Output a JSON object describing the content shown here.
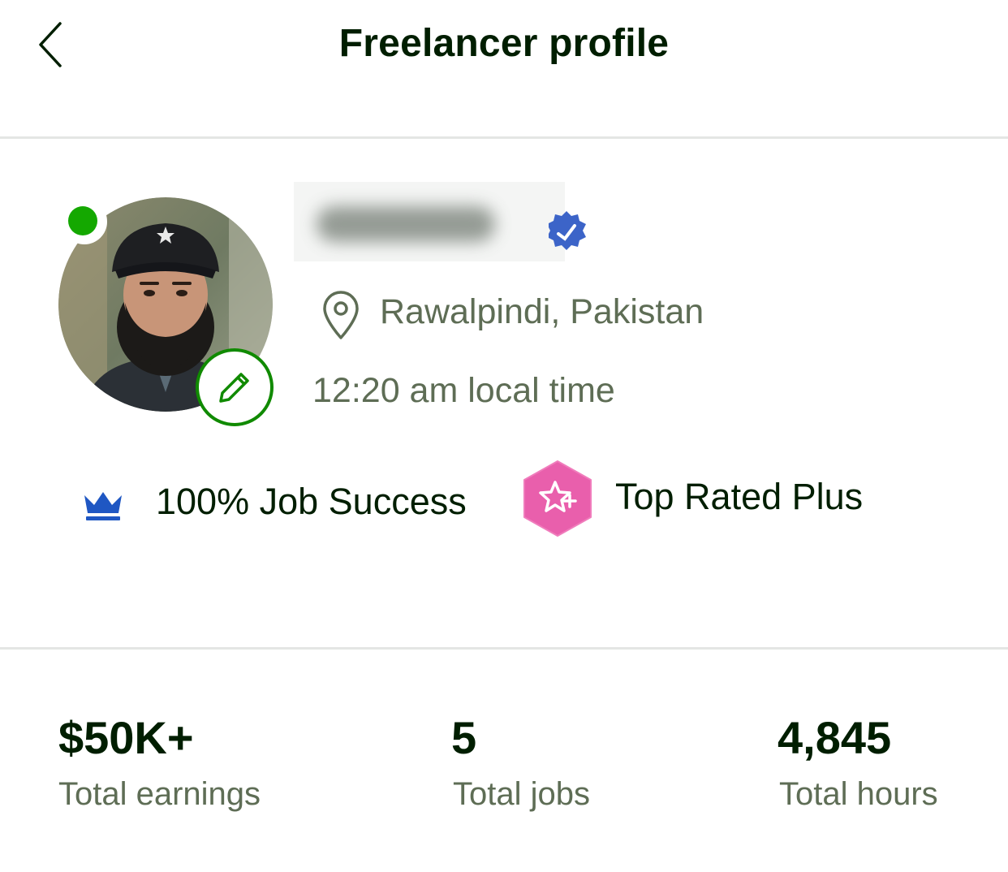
{
  "header": {
    "title": "Freelancer profile",
    "back_icon": "chevron-left-icon"
  },
  "profile": {
    "online_status": "online",
    "location": "Rawalpindi, Pakistan",
    "local_time": "12:20 am local time",
    "location_icon": "map-pin-icon",
    "verified_icon": "verified-badge-icon",
    "edit_icon": "pencil-icon"
  },
  "badges": {
    "job_success": "100% Job Success",
    "job_success_icon": "crown-icon",
    "top_rated": "Top Rated Plus",
    "top_rated_icon": "star-hexagon-icon"
  },
  "stats": [
    {
      "value": "$50K+",
      "label": "Total earnings"
    },
    {
      "value": "5",
      "label": "Total jobs"
    },
    {
      "value": "4,845",
      "label": "Total hours"
    }
  ],
  "colors": {
    "brand_green": "#14a800",
    "edit_green": "#108a00",
    "text_dark": "#001e00",
    "text_muted": "#5e6d55",
    "crown_blue": "#1f57c3",
    "verified_blue": "#3c64c8",
    "top_rated_pink": "#e95fac"
  }
}
